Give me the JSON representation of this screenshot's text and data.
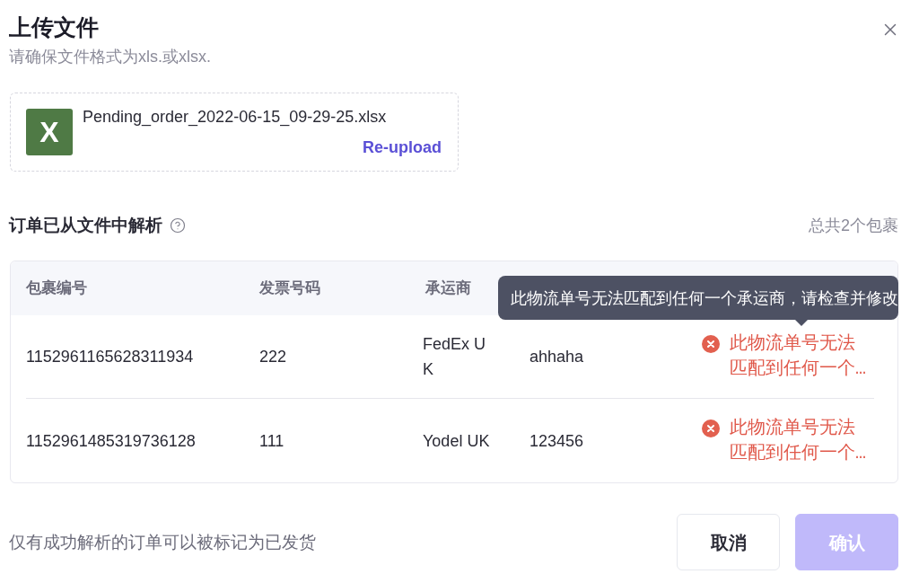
{
  "dialog": {
    "title": "上传文件",
    "subtitle": "请确保文件格式为xls.或xlsx."
  },
  "file": {
    "icon_label": "X",
    "name": "Pending_order_2022-06-15_09-29-25.xlsx",
    "action": "Re-upload"
  },
  "section": {
    "title": "订单已从文件中解析",
    "summary": "总共2个包裹"
  },
  "table": {
    "columns": [
      "包裹编号",
      "发票号码",
      "承运商"
    ],
    "rows": [
      {
        "package_no": "1152961165628311934",
        "invoice_no": "222",
        "carrier": "FedEx UK",
        "tracking_no": "ahhaha",
        "status": {
          "kind": "error",
          "message": "此物流单号无法匹配到任何一个…"
        }
      },
      {
        "package_no": "1152961485319736128",
        "invoice_no": "111",
        "carrier": "Yodel UK",
        "tracking_no": "123456",
        "status": {
          "kind": "error",
          "message": "此物流单号无法匹配到任何一个…"
        }
      }
    ],
    "tooltip": {
      "text": "此物流单号无法匹配到任何一个承运商，请检查并修改"
    }
  },
  "footer": {
    "note": "仅有成功解析的订单可以被标记为已发货",
    "buttons": [
      {
        "label": "取消",
        "kind": "secondary",
        "disabled": false
      },
      {
        "label": "确认",
        "kind": "primary",
        "disabled": true
      }
    ]
  }
}
